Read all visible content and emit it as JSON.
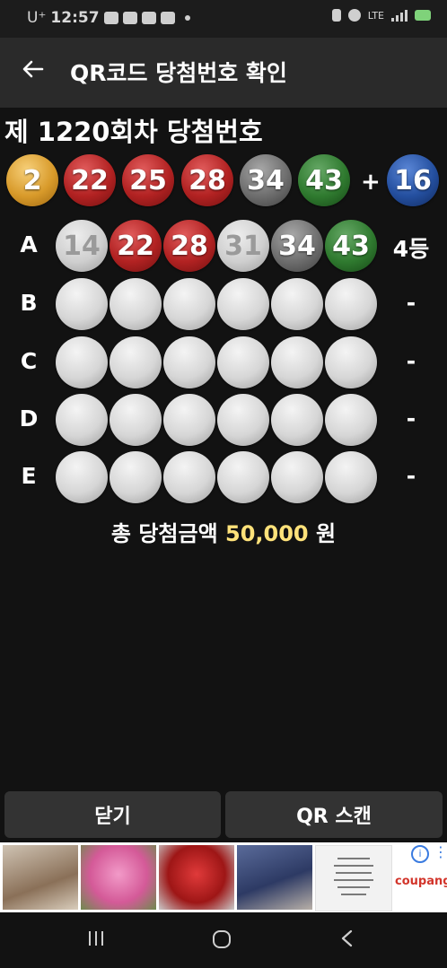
{
  "status_bar": {
    "carrier": "U⁺",
    "time": "12:57",
    "network": "LTE"
  },
  "app_bar": {
    "title": "QR코드 당첨번호 확인",
    "back_icon": "arrow-left-icon"
  },
  "draw": {
    "title": "제 1220회차 당첨번호",
    "numbers": [
      "2",
      "22",
      "25",
      "28",
      "34",
      "43"
    ],
    "plus": "+",
    "bonus": "16"
  },
  "games": [
    {
      "label": "A",
      "numbers": [
        "14",
        "22",
        "28",
        "31",
        "34",
        "43"
      ],
      "rank": "4등"
    },
    {
      "label": "B",
      "numbers": [
        "",
        "",
        "",
        "",
        "",
        ""
      ],
      "rank": "-"
    },
    {
      "label": "C",
      "numbers": [
        "",
        "",
        "",
        "",
        "",
        ""
      ],
      "rank": "-"
    },
    {
      "label": "D",
      "numbers": [
        "",
        "",
        "",
        "",
        "",
        ""
      ],
      "rank": "-"
    },
    {
      "label": "E",
      "numbers": [
        "",
        "",
        "",
        "",
        "",
        ""
      ],
      "rank": "-"
    }
  ],
  "total": {
    "prefix": "총 당첨금액",
    "amount": "50,000",
    "unit": "원"
  },
  "buttons": {
    "close": "닫기",
    "scan": "QR 스캔"
  },
  "ad": {
    "brand": "coupang"
  }
}
